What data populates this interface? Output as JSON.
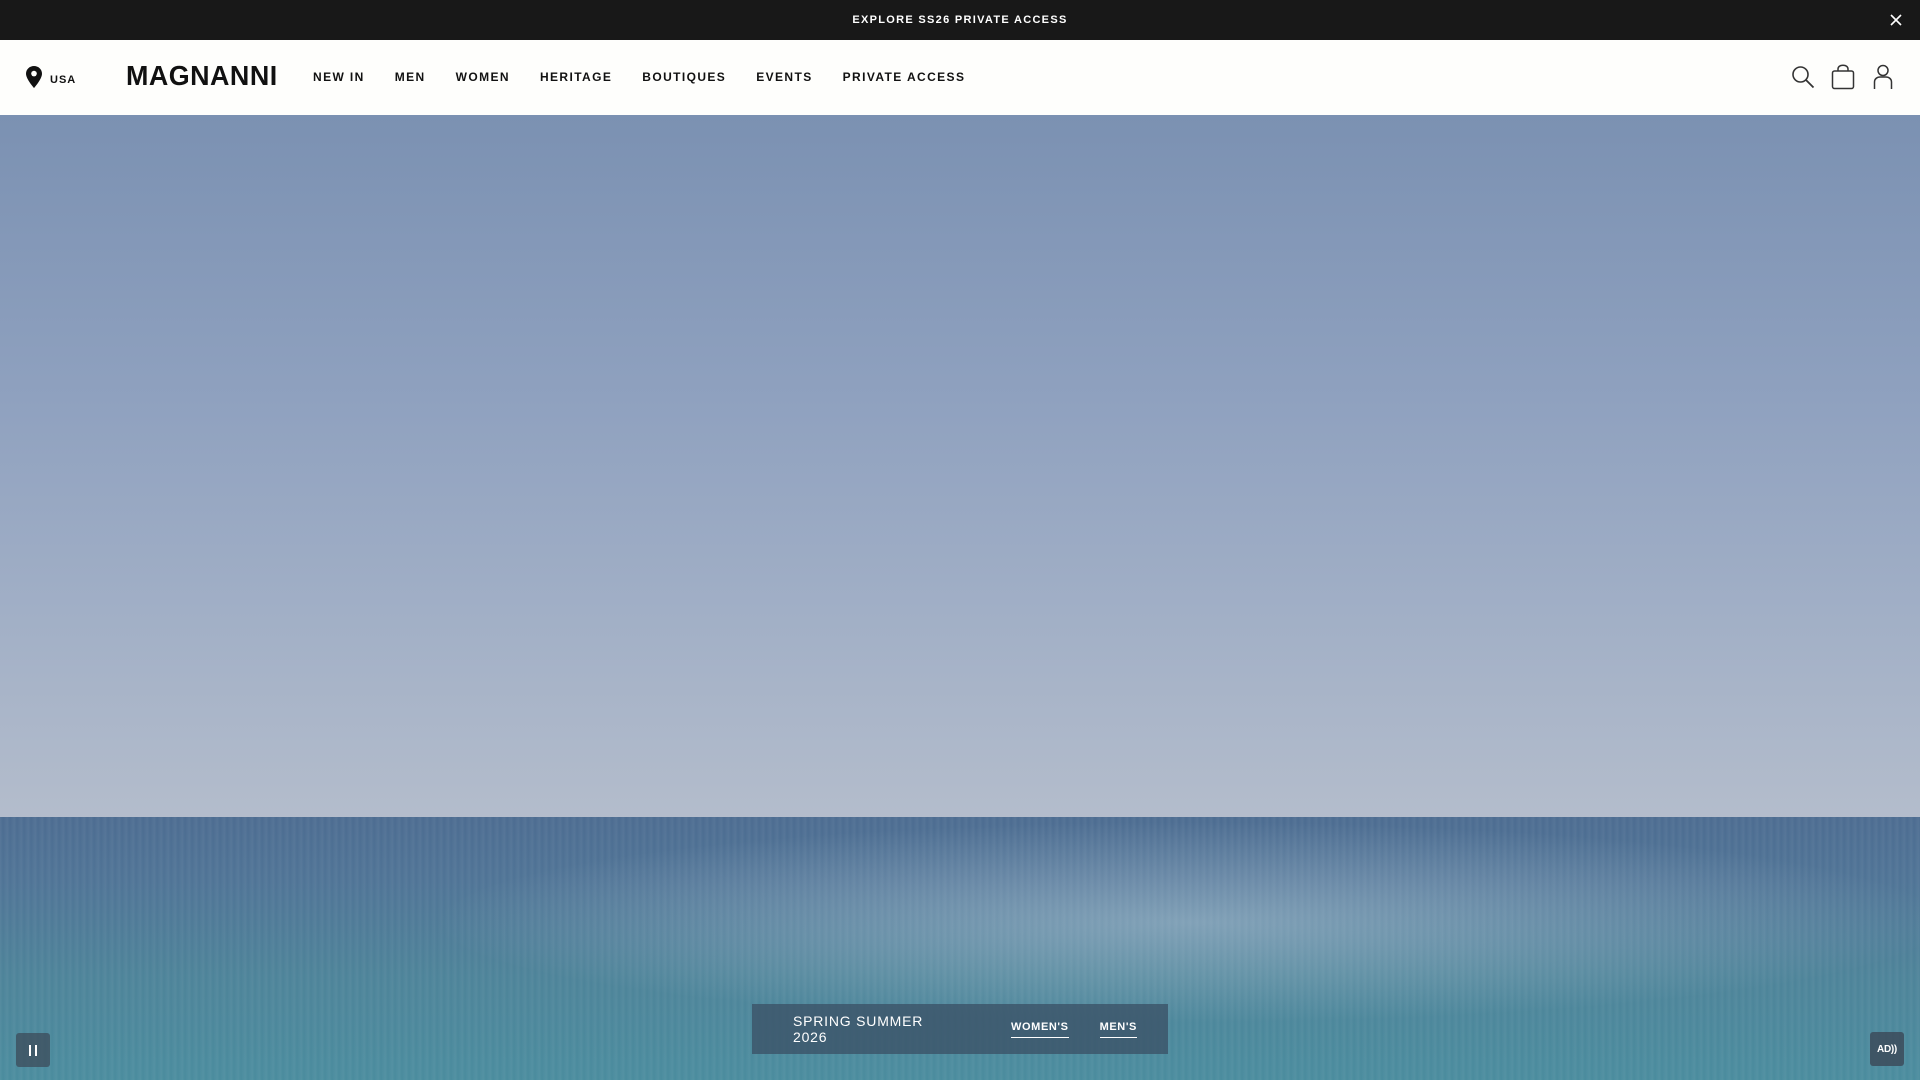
{
  "announcement": {
    "text": "EXPLORE SS26 PRIVATE ACCESS",
    "close_icon": "close-icon"
  },
  "header": {
    "location_label": "USA",
    "location_icon": "map-pin-icon",
    "logo": "MAGNANNI",
    "nav": [
      "NEW IN",
      "MEN",
      "WOMEN",
      "HERITAGE",
      "BOUTIQUES",
      "EVENTS",
      "PRIVATE ACCESS"
    ],
    "icons": [
      "search-icon",
      "shopping-bag-icon",
      "account-icon"
    ]
  },
  "hero": {
    "collection_title": "SPRING SUMMER 2026",
    "links": [
      "WOMEN'S",
      "MEN'S"
    ],
    "pause_icon": "pause-icon",
    "audio_description_label": "AD))"
  },
  "colors": {
    "announcement_bg": "#181818",
    "header_bg": "#fefefc",
    "sky_top": "#7b91b2",
    "sea": "#4f7496",
    "collection_bar_bg": "#3c5469"
  }
}
